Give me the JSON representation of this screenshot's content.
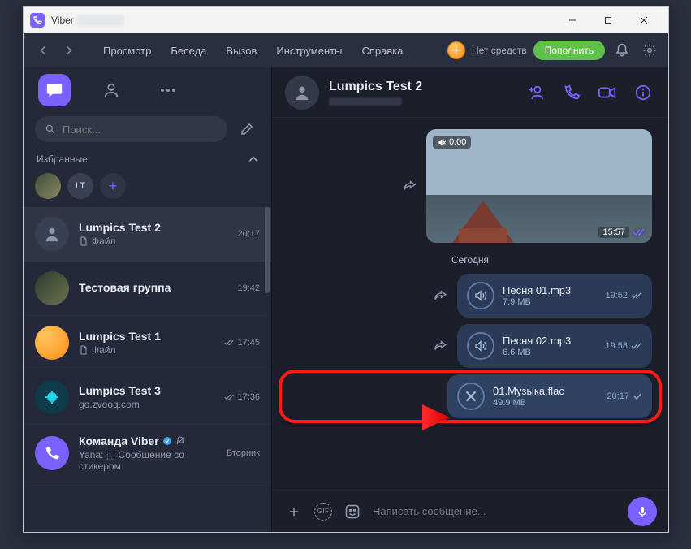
{
  "window": {
    "app_name": "Viber"
  },
  "menubar": {
    "items": [
      "Просмотр",
      "Беседа",
      "Вызов",
      "Инструменты",
      "Справка"
    ],
    "balance_label": "Нет средств",
    "topup_label": "Пополнить"
  },
  "sidebar": {
    "search_placeholder": "Поиск...",
    "section_fav": "Избранные",
    "fav_initials": "LT",
    "chats": [
      {
        "name": "Lumpics Test 2",
        "sub": "Файл",
        "time": "20:17",
        "icon": "file",
        "selected": true
      },
      {
        "name": "Тестовая группа",
        "sub": "",
        "time": "19:42",
        "icon": "photo"
      },
      {
        "name": "Lumpics Test 1",
        "sub": "Файл",
        "time": "17:45",
        "icon": "fruit",
        "read": true
      },
      {
        "name": "Lumpics Test 3",
        "sub": "go.zvooq.com",
        "time": "17:36",
        "icon": "cyan",
        "read": true
      },
      {
        "name": "Команда Viber",
        "sub": "Yana: ⬚ Сообщение со стикером",
        "time": "Вторник",
        "icon": "viber",
        "verified": true,
        "muted": true
      }
    ]
  },
  "conversation": {
    "title": "Lumpics Test 2",
    "video": {
      "mute_time": "0:00",
      "duration": "15:57"
    },
    "day_separator": "Сегодня",
    "files": [
      {
        "name": "Песня 01.mp3",
        "size": "7.9 MB",
        "time": "19:52",
        "state": "sent"
      },
      {
        "name": "Песня 02.mp3",
        "size": "6.6 MB",
        "time": "19:58",
        "state": "sent"
      },
      {
        "name": "01.Музыка.flac",
        "size": "49.9 MB",
        "time": "20:17",
        "state": "sending"
      }
    ],
    "composer_placeholder": "Написать сообщение..."
  }
}
